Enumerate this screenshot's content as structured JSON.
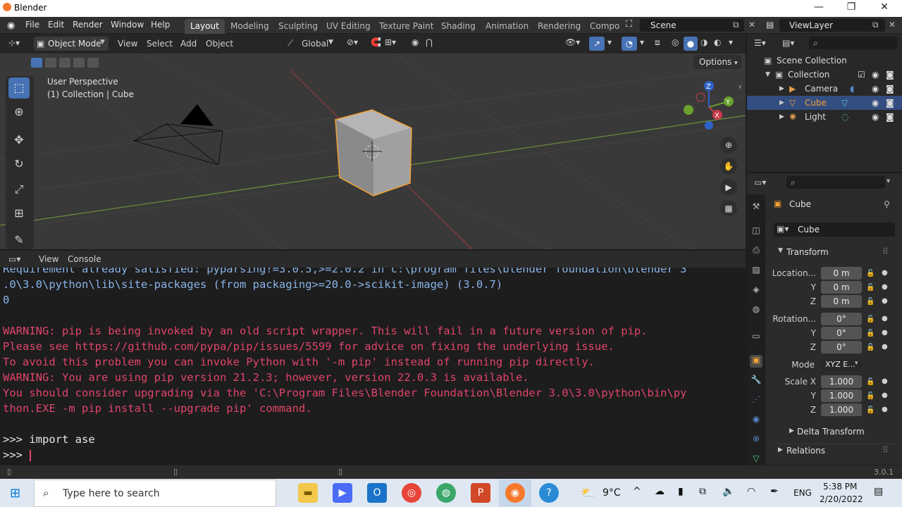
{
  "window": {
    "title": "Blender",
    "minimize": "—",
    "restore": "❐",
    "close": "✕"
  },
  "menus": [
    "File",
    "Edit",
    "Render",
    "Window",
    "Help"
  ],
  "workspaces": [
    "Layout",
    "Modeling",
    "Sculpting",
    "UV Editing",
    "Texture Paint",
    "Shading",
    "Animation",
    "Rendering",
    "Compo"
  ],
  "scene": "Scene",
  "view_layer": "ViewLayer",
  "viewport": {
    "mode": "Object Mode",
    "menu": [
      "View",
      "Select",
      "Add",
      "Object"
    ],
    "orientation": "Global",
    "info_line1": "User Perspective",
    "info_line2": "(1) Collection | Cube",
    "options": "Options",
    "gizmo": {
      "z": "Z",
      "y": "Y",
      "x": "X"
    }
  },
  "console": {
    "menu": [
      "View",
      "Console"
    ],
    "lines": [
      {
        "kind": "info",
        "text": "Requirement already satisfied: pyparsing!=3.0.5,>=2.0.2 in c:\\program files\\blender foundation\\blender 3"
      },
      {
        "kind": "info",
        "text": ".0\\3.0\\python\\lib\\site-packages (from packaging>=20.0->scikit-image) (3.0.7)"
      },
      {
        "kind": "info",
        "text": "0"
      },
      {
        "kind": "warn",
        "text": "WARNING: pip is being invoked by an old script wrapper. This will fail in a future version of pip."
      },
      {
        "kind": "warn",
        "text": "Please see https://github.com/pypa/pip/issues/5599 for advice on fixing the underlying issue."
      },
      {
        "kind": "warn",
        "text": "To avoid this problem you can invoke Python with '-m pip' instead of running pip directly."
      },
      {
        "kind": "warn",
        "text": "WARNING: You are using pip version 21.2.3; however, version 22.0.3 is available."
      },
      {
        "kind": "warn",
        "text": "You should consider upgrading via the 'C:\\Program Files\\Blender Foundation\\Blender 3.0\\3.0\\python\\bin\\py"
      },
      {
        "kind": "warn",
        "text": "thon.EXE -m pip install --upgrade pip' command."
      },
      {
        "kind": "cmd",
        "text": ">>> import ase"
      },
      {
        "kind": "cmd",
        "text": ">>> "
      }
    ]
  },
  "outliner": {
    "root": "Scene Collection",
    "collection": "Collection",
    "items": [
      "Camera",
      "Cube",
      "Light"
    ],
    "selected": "Cube"
  },
  "properties": {
    "object_name": "Cube",
    "data_name": "Cube",
    "panel_transform": "Transform",
    "location_label": "Location...",
    "location": [
      "0 m",
      "0 m",
      "0 m"
    ],
    "rotation_label": "Rotation...",
    "rotation": [
      "0°",
      "0°",
      "0°"
    ],
    "mode_label": "Mode",
    "mode_value": "XYZ E...",
    "scale_label": "Scale X",
    "scale": [
      "1.000",
      "1.000",
      "1.000"
    ],
    "axis_y": "Y",
    "axis_z": "Z",
    "delta_transform": "Delta Transform",
    "relations": "Relations"
  },
  "status": {
    "version": "3.0.1"
  },
  "taskbar": {
    "search_placeholder": "Type here to search",
    "weather": "9°C",
    "lang": "ENG",
    "time": "5:38 PM",
    "date": "2/20/2022"
  },
  "colors": {
    "accent": "#4772b3",
    "selected_object": "#f4a136",
    "warning_text": "#e0456a",
    "info_text": "#8ab4e8"
  }
}
